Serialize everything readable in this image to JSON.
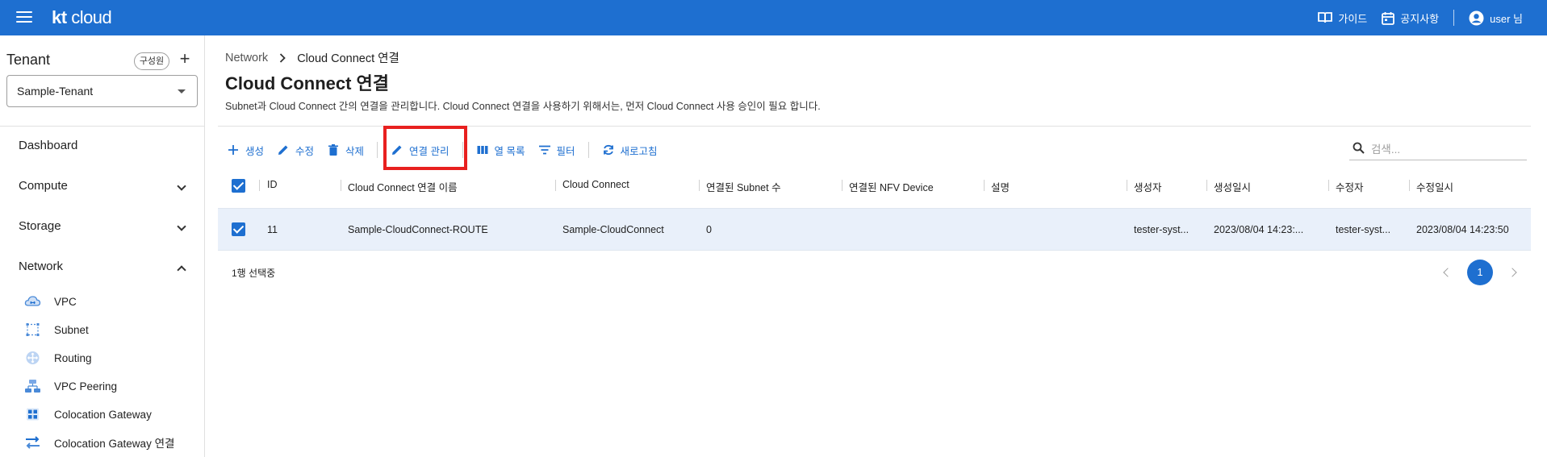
{
  "header": {
    "logo_kt": "kt",
    "logo_cloud": "cloud",
    "guide": "가이드",
    "notice": "공지사항",
    "user": "user 님",
    "brand_color": "#1e6fd0"
  },
  "sidebar": {
    "tenant_title": "Tenant",
    "member_chip": "구성원",
    "tenant_selected": "Sample-Tenant",
    "nav": [
      {
        "label": "Dashboard"
      },
      {
        "label": "Compute"
      },
      {
        "label": "Storage"
      },
      {
        "label": "Network"
      }
    ],
    "network_items": [
      {
        "label": "VPC",
        "icon": "vpc-cloud-icon"
      },
      {
        "label": "Subnet",
        "icon": "subnet-icon"
      },
      {
        "label": "Routing",
        "icon": "routing-icon"
      },
      {
        "label": "VPC Peering",
        "icon": "vpc-peering-icon"
      },
      {
        "label": "Colocation Gateway",
        "icon": "colocation-gateway-icon"
      },
      {
        "label": "Colocation Gateway 연결",
        "icon": "colocation-connection-icon"
      }
    ]
  },
  "main": {
    "breadcrumb": [
      "Network",
      "Cloud Connect 연결"
    ],
    "title": "Cloud Connect 연결",
    "description": "Subnet과 Cloud Connect 간의 연결을 관리합니다. Cloud Connect 연결을 사용하기 위해서는, 먼저 Cloud Connect 사용 승인이 필요 합니다.",
    "toolbar": {
      "create": "생성",
      "edit": "수정",
      "delete": "삭제",
      "manage_connection": "연결 관리",
      "columns": "열 목록",
      "filter": "필터",
      "refresh": "새로고침"
    },
    "search_placeholder": "검색...",
    "table": {
      "headers": [
        "ID",
        "Cloud Connect 연결 이름",
        "Cloud Connect",
        "연결된 Subnet 수",
        "연결된 NFV Device",
        "설명",
        "생성자",
        "생성일시",
        "수정자",
        "수정일시"
      ],
      "rows": [
        {
          "id": "11",
          "name": "Sample-CloudConnect-ROUTE",
          "cloud_connect": "Sample-CloudConnect",
          "subnet_count": "0",
          "nfv_device": "",
          "description": "",
          "creator": "tester-syst...",
          "created_at": "2023/08/04 14:23:...",
          "modifier": "tester-syst...",
          "modified_at": "2023/08/04 14:23:50",
          "selected": true
        }
      ]
    },
    "selected_count": "1행 선택중",
    "pagination": {
      "current": "1"
    }
  }
}
